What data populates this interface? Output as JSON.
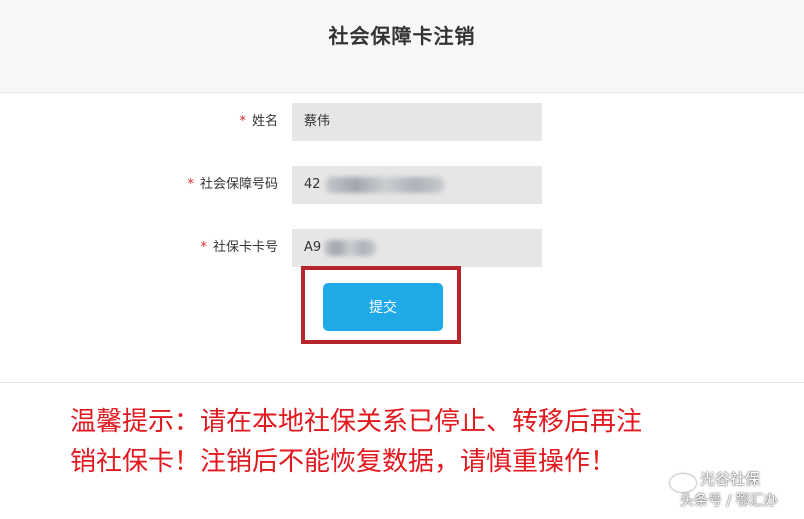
{
  "header": {
    "title": "社会保障卡注销"
  },
  "form": {
    "required_mark": "*",
    "fields": [
      {
        "label": "姓名",
        "value": "蔡伟"
      },
      {
        "label": "社会保障号码",
        "value": "42"
      },
      {
        "label": "社保卡卡号",
        "value": "A9"
      }
    ],
    "submit_label": "提交"
  },
  "notice": {
    "line1": "温馨提示：请在本地社保关系已停止、转移后再注",
    "line2": "销社保卡！注销后不能恢复数据，请慎重操作！"
  },
  "watermark": {
    "line1": "光谷社保",
    "line2": "头条号 / 鄂汇办"
  },
  "colors": {
    "accent": "#1fa9e6",
    "notice_red": "#e2191f",
    "highlight_border": "#b4262c",
    "required": "#e0282a"
  }
}
